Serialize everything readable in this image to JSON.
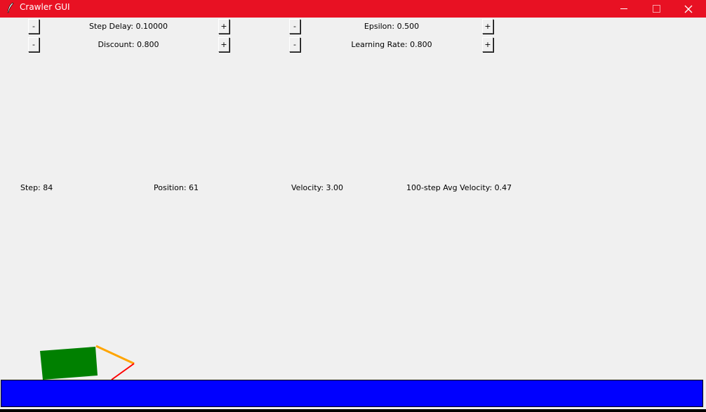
{
  "window": {
    "title": "Crawler GUI",
    "titlebar_color": "#e81123",
    "controls": [
      "minimize-icon",
      "maximize-icon",
      "close-icon"
    ]
  },
  "controls": {
    "minus": "-",
    "plus": "+",
    "step_delay": "Step Delay: 0.10000",
    "epsilon": "Epsilon: 0.500",
    "discount": "Discount: 0.800",
    "learning_rate": "Learning Rate: 0.800"
  },
  "stats": {
    "step": "Step: 84",
    "position": "Position: 61",
    "velocity": "Velocity: 3.00",
    "avg_velocity": "100-step Avg Velocity: 0.47"
  },
  "colors": {
    "ground": "#0000ff",
    "body": "#008000",
    "arm": "#ffa500",
    "hand": "#ff0000",
    "background": "#f0f0f0"
  }
}
